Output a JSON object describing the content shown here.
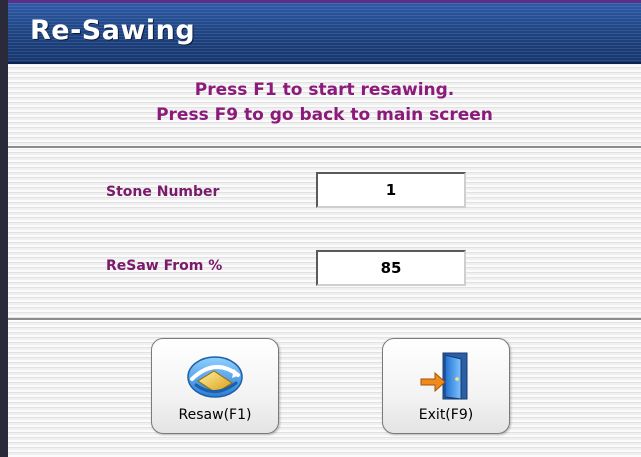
{
  "window": {
    "title": "Re-Sawing"
  },
  "instructions": {
    "line1": "Press F1 to start resawing.",
    "line2": "Press F9 to go back to main screen"
  },
  "form": {
    "stone_number": {
      "label": "Stone Number",
      "value": "1"
    },
    "resaw_from": {
      "label": "ReSaw From %",
      "value": "85"
    }
  },
  "buttons": {
    "resaw": {
      "label": "Resaw(F1)",
      "icon": "resaw-icon"
    },
    "exit": {
      "label": "Exit(F9)",
      "icon": "exit-door-icon"
    }
  },
  "colors": {
    "title_bar": "#1e4282",
    "instruction_text": "#8c1a7a",
    "label_text": "#7a1a6a"
  }
}
